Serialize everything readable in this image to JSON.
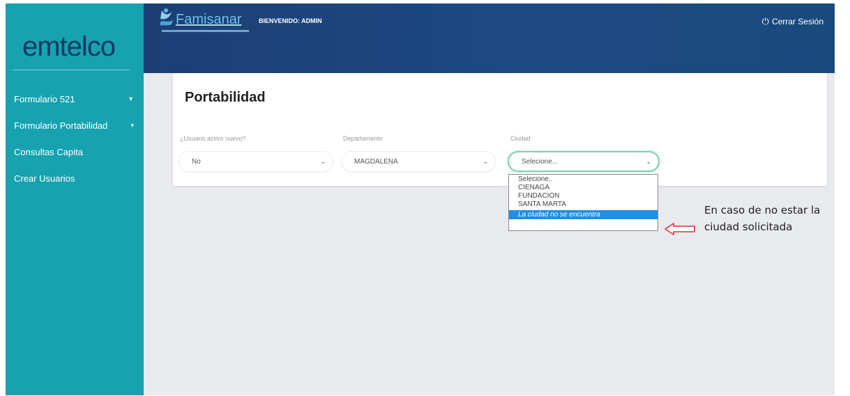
{
  "sidebar": {
    "logo": "emtelco",
    "items": [
      {
        "label": "Formulario 521",
        "caret": "▼"
      },
      {
        "label": "Formulario Portabilidad",
        "caret": "▾"
      },
      {
        "label": "Consultas Capita",
        "caret": ""
      },
      {
        "label": "Crear Usuarios",
        "caret": ""
      }
    ]
  },
  "header": {
    "brand": "Famisanar",
    "welcome": "BIENVENIDO: ADMIN",
    "logout": "Cerrar Sesión"
  },
  "main": {
    "title": "Portabilidad",
    "fields": [
      {
        "label": "¿Usuario activo nuevo?",
        "value": "No"
      },
      {
        "label": "Departamento",
        "value": "MAGDALENA"
      },
      {
        "label": "Ciudad",
        "value": "Selecione..."
      }
    ],
    "city_options": [
      "Selecione..",
      "CIENAGA",
      "FUNDACION",
      "SANTA MARTA",
      "La ciudad no se encuentra"
    ],
    "selected_option": "La ciudad no se encuentra"
  },
  "annotation": {
    "text": "En caso de no estar la ciudad solicitada"
  },
  "colors": {
    "sidebar": "#17a2b0",
    "header": "#1b3f74",
    "selected": "#1e8fe6",
    "focus": "#7fd0b8",
    "arrow": "#e0303a"
  }
}
